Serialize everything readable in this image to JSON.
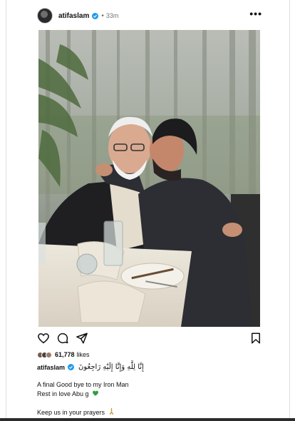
{
  "post": {
    "username": "atifaslam",
    "separator": "•",
    "time_ago": "33m",
    "more_label": "•••"
  },
  "actions": {
    "like_icon": "heart-icon",
    "comment_icon": "comment-icon",
    "share_icon": "share-icon",
    "save_icon": "bookmark-icon"
  },
  "likes": {
    "count": "61,778",
    "word": "likes"
  },
  "caption": {
    "username": "atifaslam",
    "arabic": "إِنَّا لِلَّهِ وَإِنَّا إِلَيْهِ رَاجِعُونَ",
    "line1": "A final Good bye to my Iron Man",
    "line2": "Rest in love Abu g",
    "line2_emoji": "💚",
    "line3": "Keep us in your prayers",
    "line3_emoji": "🙏"
  },
  "colors": {
    "verified": "#1d9bf0",
    "green_heart": "#2ea043"
  }
}
